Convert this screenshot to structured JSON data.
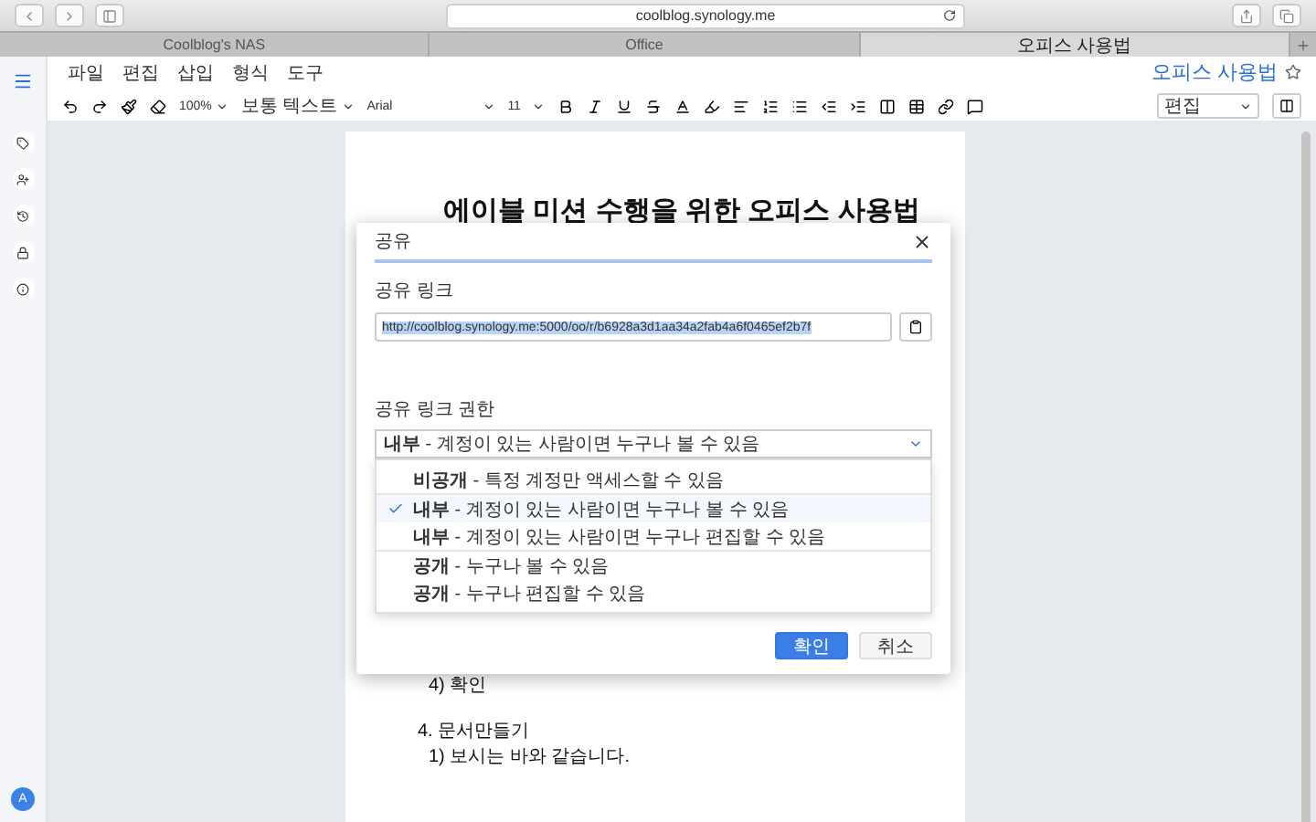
{
  "browser": {
    "url": "coolblog.synology.me",
    "tabs": [
      {
        "label": "Coolblog's NAS",
        "selected": false
      },
      {
        "label": "Office",
        "selected": false
      },
      {
        "label": "오피스 사용법",
        "selected": true
      }
    ]
  },
  "app": {
    "menu": [
      "파일",
      "편집",
      "삽입",
      "형식",
      "도구"
    ],
    "toolbar": {
      "zoom": "100%",
      "style": "보통 텍스트",
      "font": "Arial",
      "size": "11"
    },
    "doc_title": "오피스 사용법",
    "mode": "편집"
  },
  "sidebar": {
    "avatar": "A"
  },
  "document": {
    "heading": "에이블 미션 수행을 위한 오피스 사용법",
    "lines": [
      {
        "kind": "item",
        "text": "4) 확인"
      },
      {
        "kind": "gap"
      },
      {
        "kind": "section",
        "text": "4. 문서만들기"
      },
      {
        "kind": "item",
        "text": "1) 보시는 바와 같습니다."
      }
    ]
  },
  "dialog": {
    "title": "공유",
    "link_label": "공유 링크",
    "link": "http://coolblog.synology.me:5000/oo/r/b6928a3d1aa34a2fab4a6f0465ef2b7f",
    "permission_label": "공유 링크 권한",
    "permission": "**내부** - 계정이 있는 사람이면 누구나 볼 수 있음",
    "options": [
      {
        "label": "**비공개** - 특정 계정만 액세스할 수 있음",
        "selected": false,
        "group_end": true
      },
      {
        "label": "**내부** - 계정이 있는 사람이면 누구나 볼 수 있음",
        "selected": true,
        "group_end": false
      },
      {
        "label": "**내부** - 계정이 있는 사람이면 누구나 편집할 수 있음",
        "selected": false,
        "group_end": true
      },
      {
        "label": "**공개** - 누구나 볼 수 있음",
        "selected": false,
        "group_end": false
      },
      {
        "label": "**공개** - 누구나 편집할 수 있음",
        "selected": false,
        "group_end": false
      }
    ],
    "confirm": "확인",
    "cancel": "취소"
  }
}
